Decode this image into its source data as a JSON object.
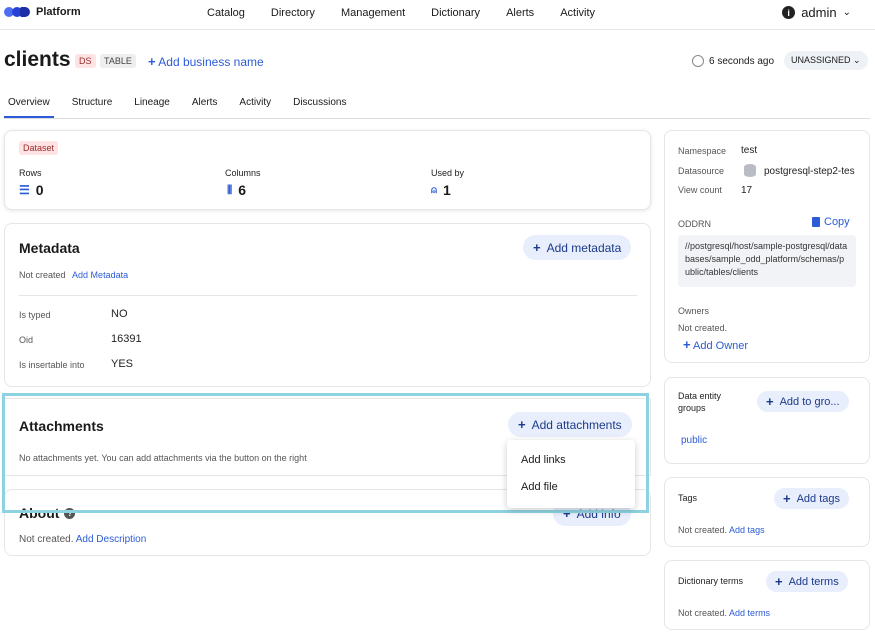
{
  "header": {
    "brand": "Platform",
    "nav": [
      "Catalog",
      "Directory",
      "Management",
      "Dictionary",
      "Alerts",
      "Activity"
    ],
    "user": "admin"
  },
  "entity": {
    "name": "clients",
    "type_badge": "DS",
    "kind_badge": "TABLE",
    "add_business_name": "Add business name",
    "updated": "6 seconds ago",
    "status": "UNASSIGNED"
  },
  "tabs": [
    "Overview",
    "Structure",
    "Lineage",
    "Alerts",
    "Activity",
    "Discussions"
  ],
  "stats": {
    "badge": "Dataset",
    "rows_label": "Rows",
    "rows": "0",
    "columns_label": "Columns",
    "columns": "6",
    "used_by_label": "Used by",
    "used_by": "1"
  },
  "metadata": {
    "title": "Metadata",
    "add_button": "Add metadata",
    "not_created": "Not created",
    "add_link": "Add Metadata",
    "rows": [
      {
        "key": "Is typed",
        "value": "NO"
      },
      {
        "key": "Oid",
        "value": "16391"
      },
      {
        "key": "Is insertable into",
        "value": "YES"
      }
    ]
  },
  "attachments": {
    "title": "Attachments",
    "add_button": "Add attachments",
    "empty": "No attachments yet. You can add attachments via the button on the right",
    "menu": [
      "Add links",
      "Add file"
    ]
  },
  "about": {
    "title": "About",
    "add_button": "Add info",
    "not_created": "Not created.",
    "add_link": "Add Description"
  },
  "sidebar": {
    "namespace_label": "Namespace",
    "namespace": "test",
    "datasource_label": "Datasource",
    "datasource": "postgresql-step2-tes",
    "view_count_label": "View count",
    "view_count": "17",
    "oddrn_label": "ODDRN",
    "copy": "Copy",
    "oddrn": "//postgresql/host/sample-postgresql/databases/sample_odd_platform/schemas/public/tables/clients",
    "owners_label": "Owners",
    "owners_not_created": "Not created.",
    "add_owner": "Add Owner",
    "groups_label": "Data entity groups",
    "add_group": "Add to gro...",
    "group": "public",
    "tags_label": "Tags",
    "add_tags": "Add tags",
    "tags_not_created": "Not created.",
    "tags_link": "Add tags",
    "terms_label": "Dictionary terms",
    "add_terms": "Add terms",
    "terms_not_created": "Not created.",
    "terms_link": "Add terms"
  }
}
